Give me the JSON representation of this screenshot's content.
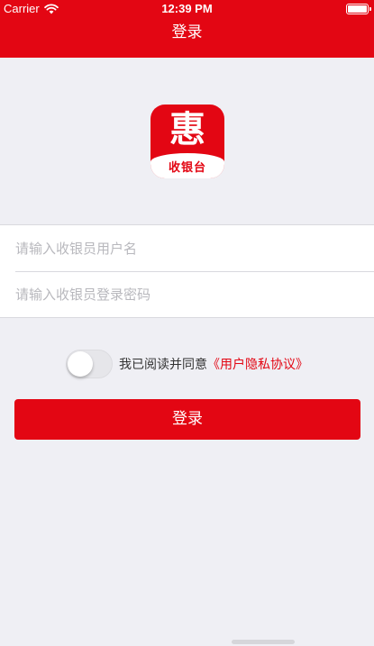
{
  "status_bar": {
    "carrier": "Carrier",
    "time": "12:39 PM",
    "wifi_icon": "wifi-icon",
    "battery_icon": "battery-icon"
  },
  "nav": {
    "title": "登录"
  },
  "logo": {
    "mark": "惠",
    "text": "收银台"
  },
  "form": {
    "username": {
      "value": "",
      "placeholder": "请输入收银员用户名"
    },
    "password": {
      "value": "",
      "placeholder": "请输入收银员登录密码"
    }
  },
  "agreement": {
    "toggle_on": false,
    "text": "我已阅读并同意",
    "link": "《用户隐私协议》"
  },
  "login_button": {
    "label": "登录"
  },
  "colors": {
    "brand_red": "#e30613",
    "background": "#efeff4",
    "placeholder": "#b8b8bd"
  }
}
